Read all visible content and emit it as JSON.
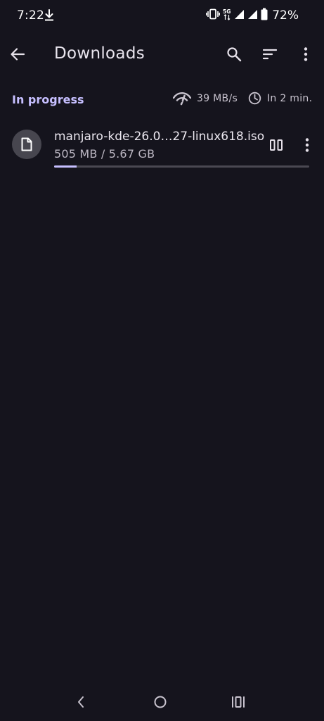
{
  "status_bar": {
    "time": "7:22",
    "battery": "72%",
    "network": "5G",
    "icons": [
      "download-icon",
      "vibrate-icon",
      "5g-icon",
      "signal-icon",
      "signal-icon",
      "battery-icon"
    ]
  },
  "app_bar": {
    "title": "Downloads",
    "icons": [
      "back-arrow-icon",
      "search-icon",
      "sort-icon",
      "more-vert-icon"
    ]
  },
  "section": {
    "title": "In progress",
    "speed": "39 MB/s",
    "eta": "In 2 min."
  },
  "downloads": [
    {
      "file_name": "manjaro-kde-26.0…27-linux618.iso",
      "size_text": "505 MB / 5.67 GB",
      "progress": 0.087,
      "icons": [
        "file-icon",
        "pause-icon",
        "more-vert-icon"
      ]
    }
  ],
  "nav_bar": {
    "icons": [
      "nav-back-icon",
      "nav-home-icon",
      "nav-recents-icon"
    ]
  },
  "colors": {
    "background": "#15141d",
    "accent": "#c6bfff",
    "text_primary": "#ebe7ef",
    "text_secondary": "#bdb8c4",
    "progress_track": "#4a4852",
    "file_icon_bg": "#47464f"
  }
}
